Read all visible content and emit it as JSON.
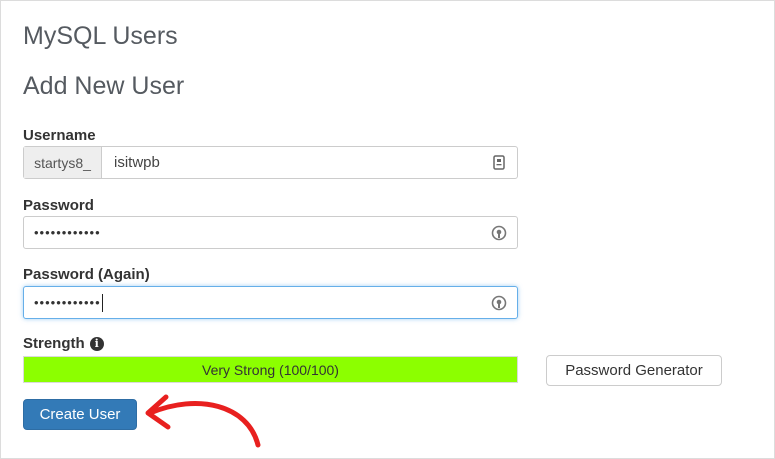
{
  "page": {
    "title": "MySQL Users",
    "section_title": "Add New User"
  },
  "username": {
    "label": "Username",
    "prefix": "startys8_",
    "value": "isitwpb",
    "icon": "id-card-icon"
  },
  "password": {
    "label": "Password",
    "value_masked": "••••••••••••",
    "icon": "key-reveal-icon"
  },
  "password_again": {
    "label": "Password (Again)",
    "value_masked": "••••••••••••",
    "icon": "key-reveal-icon",
    "focused": true
  },
  "strength": {
    "label": "Strength",
    "text": "Very Strong (100/100)",
    "score": 100,
    "max": 100,
    "fill_color": "#8cff00",
    "info_icon": "info-icon"
  },
  "buttons": {
    "password_generator": "Password Generator",
    "create_user": "Create User"
  },
  "colors": {
    "primary_button": "#337ab7",
    "annotation_arrow": "#e8201f"
  },
  "annotation": {
    "icon": "red-arrow-icon"
  }
}
